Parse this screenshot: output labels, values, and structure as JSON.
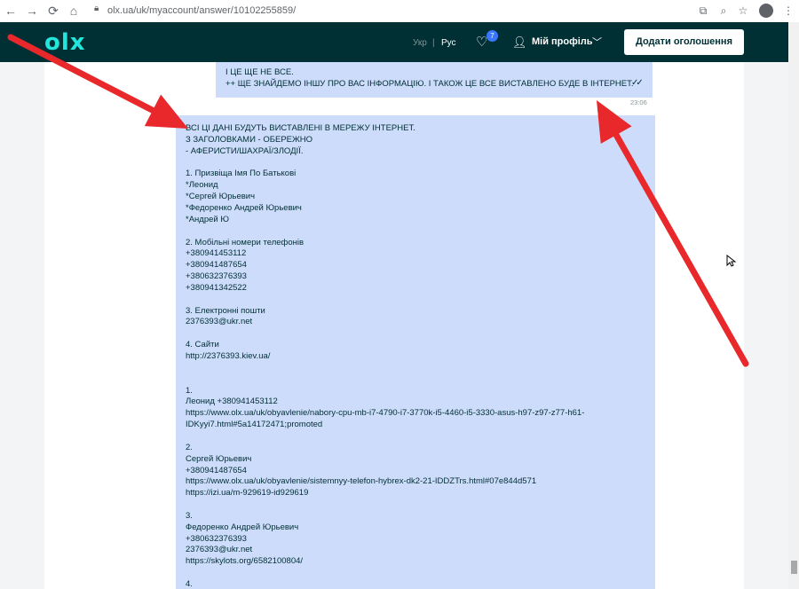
{
  "browser": {
    "url": "olx.ua/uk/myaccount/answer/10102255859/",
    "icons": [
      "back-icon",
      "forward-icon",
      "reload-icon",
      "home-icon",
      "lock-icon",
      "extension-icon",
      "zoom-icon",
      "star-icon",
      "account-icon",
      "menu-icon"
    ]
  },
  "header": {
    "logo": "olx",
    "lang_ukr": "Укр",
    "lang_sep": "|",
    "lang_rus": "Рус",
    "favorites_badge": "7",
    "profile_label": "Мій профіль",
    "post_button": "Додати оголошення",
    "colors": {
      "header_bg": "#002f34",
      "logo": "#23e5db",
      "badge": "#3a77ff"
    }
  },
  "chat": {
    "top_message": {
      "lines": [
        "І ЦЕ ЩЕ НЕ ВСЕ.",
        "++ ЩЕ ЗНАЙДЕМО ІНШУ ПРО ВАС ІНФОРМАЦІЮ. І ТАКОЖ ЦЕ ВСЕ ВИСТАВЛЕНО БУДЕ В ІНТЕРНЕТ."
      ],
      "time": "23:06"
    },
    "main_message": {
      "lines": [
        "ВСІ ЦІ ДАНІ БУДУТЬ ВИСТАВЛЕНІ В МЕРЕЖУ ІНТЕРНЕТ.",
        "З ЗАГОЛОВКАМИ - ОБЕРЕЖНО",
        "- АФЕРИСТИ/ШАХРАЇ/ЗЛОДІЇ.",
        "",
        "1. Призвіща Імя По Батькові",
        "*Леонид",
        "*Сергей Юрьевич",
        "*Федоренко Андрей Юрьевич",
        "*Андрей Ю",
        "",
        "2. Мобільні номери телефонів",
        "+380941453112",
        "+380941487654",
        "+380632376393",
        "+380941342522",
        "",
        "3. Електронні пошти",
        "2376393@ukr.net",
        "",
        "4. Сайти",
        "http://2376393.kiev.ua/",
        "",
        "",
        "1.",
        "Леонид +380941453112",
        "https://www.olx.ua/uk/obyavlenie/nabory-cpu-mb-i7-4790-i7-3770k-i5-4460-i5-3330-asus-h97-z97-z77-h61-",
        "IDKyyi7.html#5a14172471;promoted",
        "",
        "2.",
        "Сергей Юрьевич",
        "+380941487654",
        "https://www.olx.ua/uk/obyavlenie/sistemnyy-telefon-hybrex-dk2-21-IDDZTrs.html#07e844d571",
        "https://izi.ua/m-929619-id929619",
        "",
        "3.",
        "Федоренко Андрей Юрьевич",
        "+380632376393",
        "2376393@ukr.net",
        "https://skylots.org/6582100804/",
        "",
        "4."
      ]
    },
    "colors": {
      "bubble": "#cddcfb",
      "text": "#002f34"
    }
  },
  "overlay": {
    "arrow_color": "#e8282b"
  }
}
